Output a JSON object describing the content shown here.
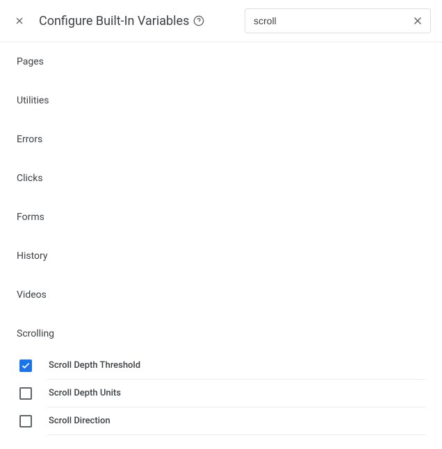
{
  "header": {
    "title": "Configure Built-In Variables",
    "search_value": "scroll"
  },
  "categories": [
    {
      "label": "Pages"
    },
    {
      "label": "Utilities"
    },
    {
      "label": "Errors"
    },
    {
      "label": "Clicks"
    },
    {
      "label": "Forms"
    },
    {
      "label": "History"
    },
    {
      "label": "Videos"
    },
    {
      "label": "Scrolling"
    }
  ],
  "scrolling_vars": [
    {
      "label": "Scroll Depth Threshold",
      "checked": true
    },
    {
      "label": "Scroll Depth Units",
      "checked": false
    },
    {
      "label": "Scroll Direction",
      "checked": false
    }
  ]
}
